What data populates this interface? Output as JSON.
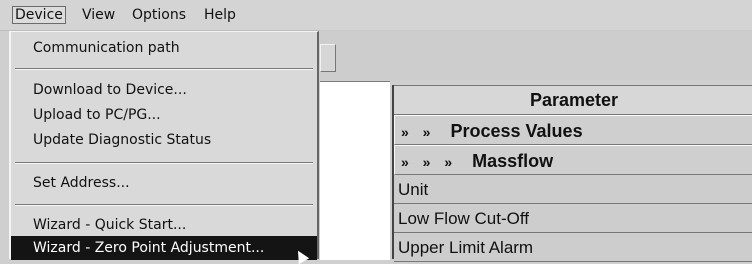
{
  "menubar": {
    "items": [
      {
        "label": "Device"
      },
      {
        "label": "View"
      },
      {
        "label": "Options"
      },
      {
        "label": "Help"
      }
    ]
  },
  "device_menu": {
    "items": [
      {
        "label": "Communication path"
      },
      {
        "label": "Download to Device..."
      },
      {
        "label": "Upload to PC/PG..."
      },
      {
        "label": "Update Diagnostic Status"
      },
      {
        "label": "Set Address..."
      },
      {
        "label": "Wizard - Quick Start..."
      },
      {
        "label": "Wizard - Zero Point Adjustment..."
      }
    ],
    "highlighted": "Wizard - Zero Point Adjustment..."
  },
  "parameter_table": {
    "header": "Parameter",
    "groups": [
      {
        "arrows": "» »",
        "label": "Process Values"
      },
      {
        "arrows": "» » »",
        "label": "Massflow"
      }
    ],
    "rows": [
      {
        "label": "Unit"
      },
      {
        "label": "Low Flow Cut-Off"
      },
      {
        "label": "Upper Limit Alarm"
      }
    ]
  }
}
